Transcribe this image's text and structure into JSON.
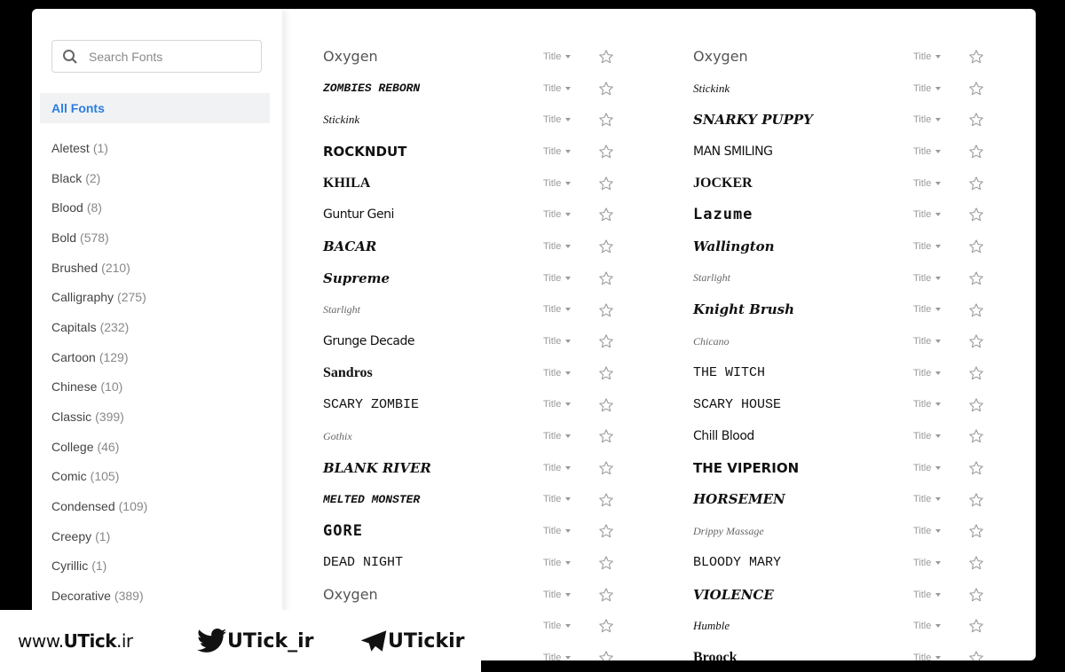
{
  "sidebar": {
    "search_placeholder": "Search Fonts",
    "all_fonts": "All Fonts",
    "categories": [
      {
        "label": "Aletest",
        "count": "(1)"
      },
      {
        "label": "Black",
        "count": "(2)"
      },
      {
        "label": "Blood",
        "count": "(8)"
      },
      {
        "label": "Bold",
        "count": "(578)"
      },
      {
        "label": "Brushed",
        "count": "(210)"
      },
      {
        "label": "Calligraphy",
        "count": "(275)"
      },
      {
        "label": "Capitals",
        "count": "(232)"
      },
      {
        "label": "Cartoon",
        "count": "(129)"
      },
      {
        "label": "Chinese",
        "count": "(10)"
      },
      {
        "label": "Classic",
        "count": "(399)"
      },
      {
        "label": "College",
        "count": "(46)"
      },
      {
        "label": "Comic",
        "count": "(105)"
      },
      {
        "label": "Condensed",
        "count": "(109)"
      },
      {
        "label": "Creepy",
        "count": "(1)"
      },
      {
        "label": "Cyrillic",
        "count": "(1)"
      },
      {
        "label": "Decorative",
        "count": "(389)"
      }
    ]
  },
  "title_select_label": "Title",
  "fonts_left": [
    {
      "name": "Oxygen",
      "style": "s0"
    },
    {
      "name": "ZOMBIES REBORN",
      "style": "s1"
    },
    {
      "name": "Stickink",
      "style": "s2"
    },
    {
      "name": "ROCKNDUT",
      "style": "s3"
    },
    {
      "name": "KHILA",
      "style": "s4"
    },
    {
      "name": "Guntur Geni",
      "style": "s5"
    },
    {
      "name": "BACAR",
      "style": "s6"
    },
    {
      "name": "Supreme",
      "style": "s6"
    },
    {
      "name": "Starlight",
      "style": "s7"
    },
    {
      "name": "Grunge Decade",
      "style": "s5"
    },
    {
      "name": "Sandros",
      "style": "s4"
    },
    {
      "name": "SCARY ZOMBIE",
      "style": "s8"
    },
    {
      "name": "Gothix",
      "style": "s7"
    },
    {
      "name": "BLANK RIVER",
      "style": "s6"
    },
    {
      "name": "MELTED MONSTER",
      "style": "s1"
    },
    {
      "name": "GORE",
      "style": "s9"
    },
    {
      "name": "DEAD NIGHT",
      "style": "s8"
    },
    {
      "name": "Oxygen",
      "style": "s0"
    },
    {
      "name": "",
      "style": "s0"
    },
    {
      "name": "",
      "style": "s0"
    }
  ],
  "fonts_right": [
    {
      "name": "Oxygen",
      "style": "s0"
    },
    {
      "name": "Stickink",
      "style": "s2"
    },
    {
      "name": "SNARKY PUPPY",
      "style": "s6"
    },
    {
      "name": "MAN SMILING",
      "style": "s5"
    },
    {
      "name": "JOCKER",
      "style": "s4"
    },
    {
      "name": "Lazume",
      "style": "s9"
    },
    {
      "name": "Wallington",
      "style": "s6"
    },
    {
      "name": "Starlight",
      "style": "s7"
    },
    {
      "name": "Knight Brush",
      "style": "s6"
    },
    {
      "name": "Chicano",
      "style": "s7"
    },
    {
      "name": "THE WITCH",
      "style": "s8"
    },
    {
      "name": "SCARY HOUSE",
      "style": "s8"
    },
    {
      "name": "Chill Blood",
      "style": "s5"
    },
    {
      "name": "THE VIPERION",
      "style": "s3"
    },
    {
      "name": "HORSEMEN",
      "style": "s6"
    },
    {
      "name": "Drippy Massage",
      "style": "s7"
    },
    {
      "name": "BLOODY MARY",
      "style": "s8"
    },
    {
      "name": "VIOLENCE",
      "style": "s6"
    },
    {
      "name": "Humble",
      "style": "s2"
    },
    {
      "name": "Broock",
      "style": "s4"
    }
  ],
  "watermark": {
    "site_prefix": "www.",
    "site_brand": "UTick",
    "site_suffix": ".ir",
    "twitter": "UTick_ir",
    "telegram": "UTickir"
  }
}
